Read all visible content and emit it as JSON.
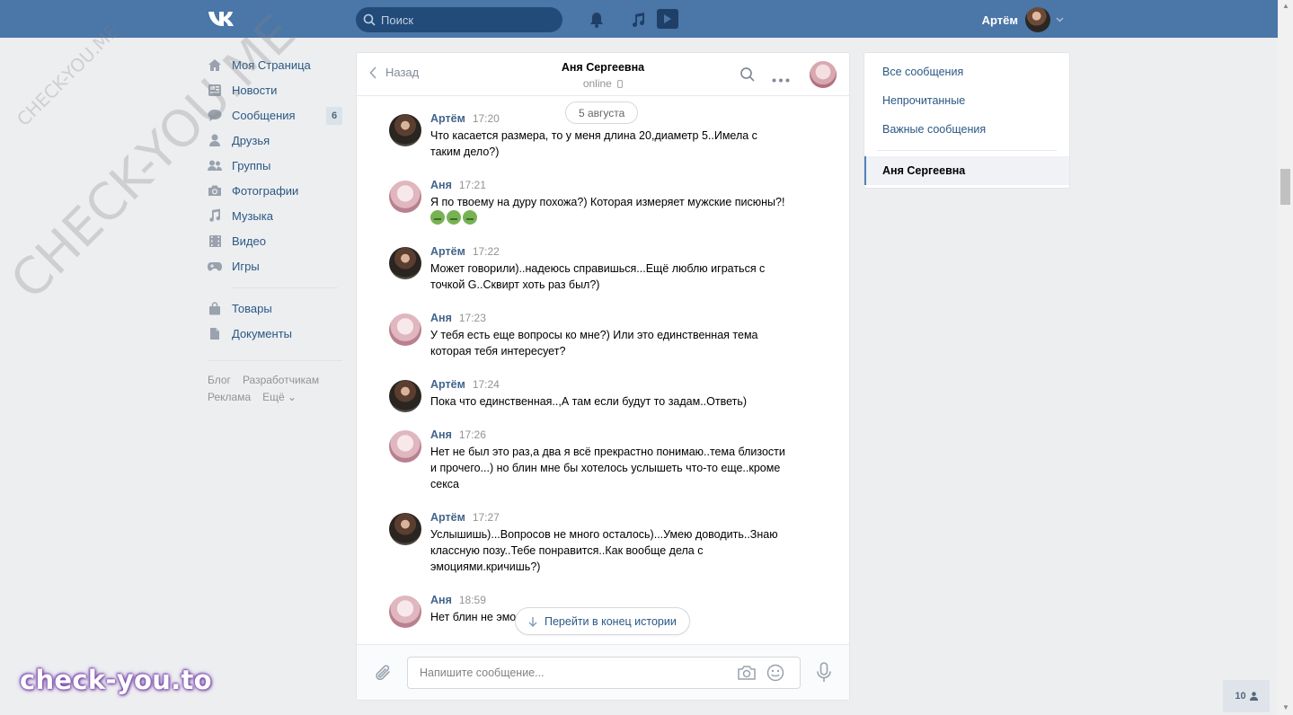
{
  "header": {
    "search_placeholder": "Поиск",
    "user_name": "Артём",
    "icons": [
      "vk-logo-icon",
      "search-icon",
      "bell-icon",
      "music-note-icon",
      "play-icon",
      "chevron-down-icon"
    ]
  },
  "sidebar": {
    "items": [
      {
        "label": "Моя Страница",
        "icon": "home-icon"
      },
      {
        "label": "Новости",
        "icon": "news-icon"
      },
      {
        "label": "Сообщения",
        "icon": "message-icon",
        "badge": "6"
      },
      {
        "label": "Друзья",
        "icon": "person-icon"
      },
      {
        "label": "Группы",
        "icon": "group-icon"
      },
      {
        "label": "Фотографии",
        "icon": "camera-icon"
      },
      {
        "label": "Музыка",
        "icon": "music-icon"
      },
      {
        "label": "Видео",
        "icon": "film-icon"
      },
      {
        "label": "Игры",
        "icon": "gamepad-icon"
      }
    ],
    "extra_items": [
      {
        "label": "Товары",
        "icon": "bag-icon"
      },
      {
        "label": "Документы",
        "icon": "document-icon"
      }
    ],
    "footer": {
      "blog": "Блог",
      "developers": "Разработчикам",
      "ads": "Реклама",
      "more": "Ещё ⌄"
    }
  },
  "chat": {
    "back_label": "Назад",
    "peer_name": "Аня Сергеевна",
    "peer_status": "online",
    "date_divider": "5 августа",
    "messages": [
      {
        "author": "Артём",
        "time": "17:20",
        "text": "Что касается размера, то у меня длина 20,диаметр 5..Имела с таким дело?)"
      },
      {
        "author": "Аня",
        "time": "17:21",
        "text": "Я по твоему на дуру похожа?) Которая измеряет мужские писюны?!"
      },
      {
        "author": "Артём",
        "time": "17:22",
        "text": "Может говорили)..надеюсь справишься...Ещё люблю играться с точкой G..Сквирт хоть раз был?)"
      },
      {
        "author": "Аня",
        "time": "17:23",
        "text": "У тебя есть еще вопросы ко мне?) Или это единственная тема которая тебя интересует?"
      },
      {
        "author": "Артём",
        "time": "17:24",
        "text": "Пока что единственная..,А там если будут то задам..Ответь)"
      },
      {
        "author": "Аня",
        "time": "17:26",
        "text": "Нет не был это раз,а два я всё прекрастно понимаю..тема близости и прочего...) но блин мне бы хотелось услышеть что-то еще..кроме секса"
      },
      {
        "author": "Артём",
        "time": "17:27",
        "text": "Услышишь)...Вопросов не много осталось)...Умею доводить..Знаю классную позу..Тебе понравится..Как вообще дела с эмоциями.кричишь?)"
      },
      {
        "author": "Аня",
        "time": "18:59",
        "text": "Нет блин не эмо"
      }
    ],
    "jump_to_end": "Перейти в конец истории",
    "composer_placeholder": "Напишите сообщение..."
  },
  "right_panel": {
    "all_messages": "Все сообщения",
    "unread": "Непрочитанные",
    "important": "Важные сообщения",
    "active_dialog": "Аня Сергеевна"
  },
  "online_counter": "10",
  "watermark": {
    "diagonal_large": "CHECK-YOU.ME",
    "diagonal_small": "CHECK-YOU.ME",
    "bottom": "check-you.to"
  },
  "colors": {
    "header": "#4a76a8",
    "link": "#2a5885",
    "background": "#edeef0"
  }
}
